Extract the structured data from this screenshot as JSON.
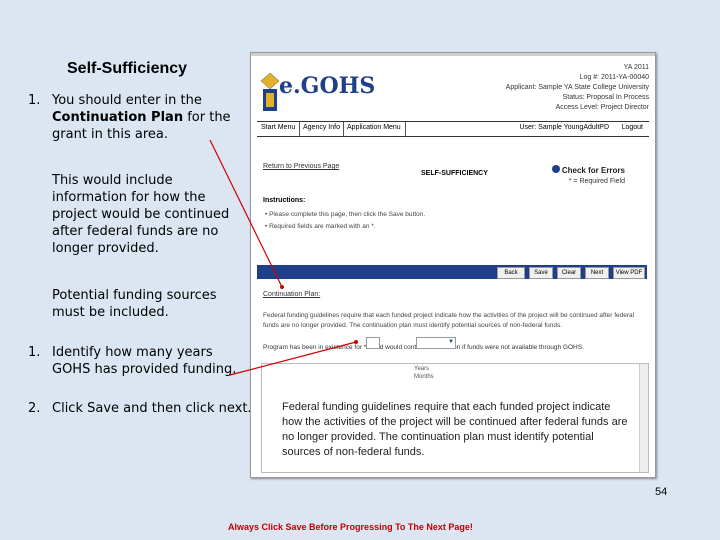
{
  "slide": {
    "title": "Self-Sufficiency",
    "bullets": [
      {
        "num": "1.",
        "text_part1": "You should enter in the",
        "bold": "Continuation Plan",
        "text_part2": " for the grant in this area."
      },
      {
        "num": "1.",
        "text": "Identify how many years GOHS has provided funding."
      },
      {
        "num": "2.",
        "text": "Click Save and then click next."
      }
    ],
    "sub1": "This would include information for how the project would be continued after federal funds are no longer provided.",
    "sub2": "Potential funding sources must be included.",
    "page_number": "54",
    "footer": "Always Click Save Before Progressing To The Next Page!",
    "callout": "Federal funding guidelines require that each funded project indicate how the activities of the project will be continued after federal funds are no longer provided. The continuation plan must identify potential sources of non-federal funds."
  },
  "egohs": {
    "logo": "e.GOHS",
    "header_lines": [
      "YA 2011",
      "Log #: 2011-YA-00040",
      "Applicant: Sample YA State College University",
      "Status: Proposal In Process",
      "Access Level: Project Director"
    ],
    "nav": [
      "Start Menu",
      "Agency Info",
      "Application Menu"
    ],
    "user": "User: Sample YoungAdultPD",
    "logout": "Logout",
    "return_link": "Return to Previous Page",
    "section_title": "SELF-SUFFICIENCY",
    "check_errors": "Check for Errors",
    "required_note": "* = Required Field",
    "instructions_title": "Instructions:",
    "instructions": [
      "• Please complete this page, then click the Save button.",
      "• Required fields are marked with an *."
    ],
    "buttons": [
      "Back",
      "Save",
      "Clear",
      "Next",
      "View PDF"
    ],
    "cp_label": "Continuation Plan:",
    "cp_text": "Federal funding guidelines require that each funded project indicate how the activities of the project will be continued after federal funds are no longer provided. The continuation plan must identify potential sources of non-federal funds.",
    "cp_question": "Program has been in existence for          *          * and would continue to function if funds were not available through GOHS.",
    "options": [
      "Years",
      "Months"
    ]
  },
  "colors": {
    "background": "#dce6f2",
    "nav_blue": "#1f3f8a",
    "footer_red": "#c00000",
    "arrow_red": "#d00000"
  }
}
